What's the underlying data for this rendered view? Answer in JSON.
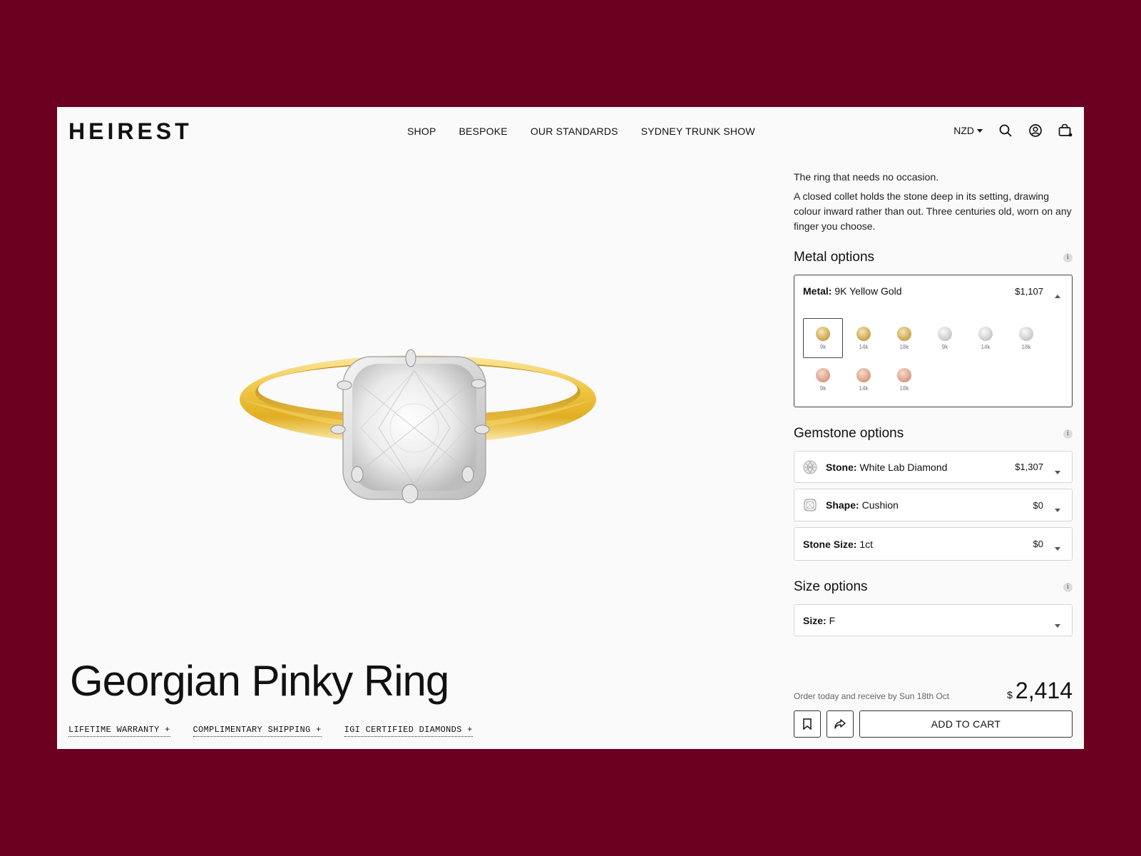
{
  "brand": "HEIREST",
  "nav": [
    "SHOP",
    "BESPOKE",
    "OUR STANDARDS",
    "SYDNEY TRUNK SHOW"
  ],
  "header": {
    "currency": "NZD",
    "icons": [
      "search-icon",
      "account-icon",
      "cart-icon"
    ]
  },
  "product": {
    "title": "Georgian Pinky Ring",
    "features": [
      "LIFETIME WARRANTY +",
      "COMPLIMENTARY SHIPPING +",
      "IGI CERTIFIED DIAMONDS +"
    ],
    "tagline": "The ring that needs no occasion.",
    "description": "A closed collet holds the stone deep in its setting, drawing colour inward rather than out. Three centuries old, worn on any finger you choose."
  },
  "metal": {
    "section_title": "Metal options",
    "label": "Metal:",
    "value": "9K Yellow Gold",
    "price": "$1,107",
    "swatches": [
      {
        "label": "9k",
        "tone": "gold",
        "selected": true
      },
      {
        "label": "14k",
        "tone": "gold",
        "selected": false
      },
      {
        "label": "18k",
        "tone": "gold",
        "selected": false
      },
      {
        "label": "9k",
        "tone": "white",
        "selected": false
      },
      {
        "label": "14k",
        "tone": "white",
        "selected": false
      },
      {
        "label": "18k",
        "tone": "white",
        "selected": false
      },
      {
        "label": "9k",
        "tone": "rose",
        "selected": false
      },
      {
        "label": "14k",
        "tone": "rose",
        "selected": false
      },
      {
        "label": "18k",
        "tone": "rose",
        "selected": false
      }
    ]
  },
  "gemstone": {
    "section_title": "Gemstone options",
    "stone": {
      "label": "Stone:",
      "value": "White Lab Diamond",
      "price": "$1,307"
    },
    "shape": {
      "label": "Shape:",
      "value": "Cushion",
      "price": "$0"
    },
    "size": {
      "label": "Stone Size:",
      "value": "1ct",
      "price": "$0"
    }
  },
  "size": {
    "section_title": "Size options",
    "label": "Size:",
    "value": "F"
  },
  "checkout": {
    "delivery_note": "Order today and receive by Sun 18th Oct",
    "currency_symbol": "$",
    "total": "2,414",
    "add_to_cart": "ADD TO CART"
  },
  "colors": {
    "background": "#6b0020",
    "page": "#fafafa",
    "gold": "#e2b93b",
    "silver": "#d8d8d8"
  }
}
